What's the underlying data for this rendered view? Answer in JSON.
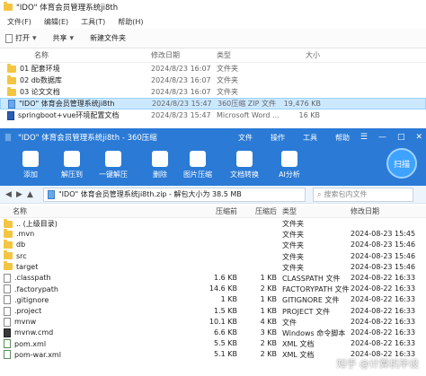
{
  "explorer": {
    "title": "\"IDO\" 体育会员管理系统ji8th",
    "menu": [
      "文件(F)",
      "编辑(E)",
      "工具(T)",
      "帮助(H)"
    ],
    "toolbar": {
      "open": "打开",
      "share": "共享",
      "new_folder": "新建文件夹"
    },
    "columns": {
      "name": "名称",
      "date": "修改日期",
      "type": "类型",
      "size": "大小"
    },
    "rows": [
      {
        "name": "01 配套环境",
        "date": "2024/8/23 16:07",
        "type": "文件夹",
        "size": "",
        "icon": "folder"
      },
      {
        "name": "02 db数据库",
        "date": "2024/8/23 16:07",
        "type": "文件夹",
        "size": "",
        "icon": "folder"
      },
      {
        "name": "03 论文文档",
        "date": "2024/8/23 16:07",
        "type": "文件夹",
        "size": "",
        "icon": "folder"
      },
      {
        "name": "\"IDO\" 体育会员管理系统ji8th",
        "date": "2024/8/23 15:47",
        "type": "360压缩 ZIP 文件",
        "size": "19,476 KB",
        "icon": "zip"
      },
      {
        "name": "springboot+vue环境配置文档",
        "date": "2024/8/23 15:47",
        "type": "Microsoft Word ...",
        "size": "16 KB",
        "icon": "doc"
      }
    ]
  },
  "zip": {
    "title": "\"IDO\" 体育会员管理系统ji8th - 360压缩",
    "menu": [
      "文件",
      "操作",
      "工具",
      "帮助"
    ],
    "window_controls": [
      "☰",
      "—",
      "□",
      "✕"
    ],
    "tools": [
      {
        "label": "添加",
        "icon": "add-icon"
      },
      {
        "label": "解压到",
        "icon": "extract-to-icon"
      },
      {
        "label": "一键解压",
        "icon": "one-click-extract-icon"
      },
      {
        "label": "删除",
        "icon": "delete-icon"
      },
      {
        "label": "图片压缩",
        "icon": "image-compress-icon"
      },
      {
        "label": "文档转换",
        "icon": "doc-convert-icon"
      },
      {
        "label": "AI分析",
        "icon": "ai-icon"
      }
    ],
    "scan_label": "扫描",
    "address": "\"IDO\" 体育会员管理系统ji8th.zip - 解包大小为 38.5 MB",
    "search_placeholder": "搜索包内文件",
    "columns": {
      "name": "名称",
      "compressed": "压缩前",
      "original": "压缩后",
      "type": "类型",
      "date": "修改日期"
    },
    "rows": [
      {
        "name": ".. (上级目录)",
        "compressed": "",
        "original": "",
        "type": "文件夹",
        "date": "",
        "icon": "folder"
      },
      {
        "name": ".mvn",
        "compressed": "",
        "original": "",
        "type": "文件夹",
        "date": "2024-08-23 15:45",
        "icon": "folder"
      },
      {
        "name": "db",
        "compressed": "",
        "original": "",
        "type": "文件夹",
        "date": "2024-08-23 15:46",
        "icon": "folder"
      },
      {
        "name": "src",
        "compressed": "",
        "original": "",
        "type": "文件夹",
        "date": "2024-08-23 15:46",
        "icon": "folder"
      },
      {
        "name": "target",
        "compressed": "",
        "original": "",
        "type": "文件夹",
        "date": "2024-08-23 15:46",
        "icon": "folder"
      },
      {
        "name": ".classpath",
        "compressed": "1.6 KB",
        "original": "1 KB",
        "type": "CLASSPATH 文件",
        "date": "2024-08-22 16:33",
        "icon": "file"
      },
      {
        "name": ".factorypath",
        "compressed": "14.6 KB",
        "original": "2 KB",
        "type": "FACTORYPATH 文件",
        "date": "2024-08-22 16:33",
        "icon": "file"
      },
      {
        "name": ".gitignore",
        "compressed": "1 KB",
        "original": "1 KB",
        "type": "GITIGNORE 文件",
        "date": "2024-08-22 16:33",
        "icon": "file"
      },
      {
        "name": ".project",
        "compressed": "1.5 KB",
        "original": "1 KB",
        "type": "PROJECT 文件",
        "date": "2024-08-22 16:33",
        "icon": "file"
      },
      {
        "name": "mvnw",
        "compressed": "10.1 KB",
        "original": "4 KB",
        "type": "文件",
        "date": "2024-08-22 16:33",
        "icon": "file"
      },
      {
        "name": "mvnw.cmd",
        "compressed": "6.6 KB",
        "original": "3 KB",
        "type": "Windows 命令脚本",
        "date": "2024-08-22 16:33",
        "icon": "cmd"
      },
      {
        "name": "pom.xml",
        "compressed": "5.5 KB",
        "original": "2 KB",
        "type": "XML 文档",
        "date": "2024-08-22 16:33",
        "icon": "xml"
      },
      {
        "name": "pom-war.xml",
        "compressed": "5.1 KB",
        "original": "2 KB",
        "type": "XML 文档",
        "date": "2024-08-22 16:33",
        "icon": "xml"
      }
    ],
    "watermark": "知乎 @计算机毕设"
  }
}
